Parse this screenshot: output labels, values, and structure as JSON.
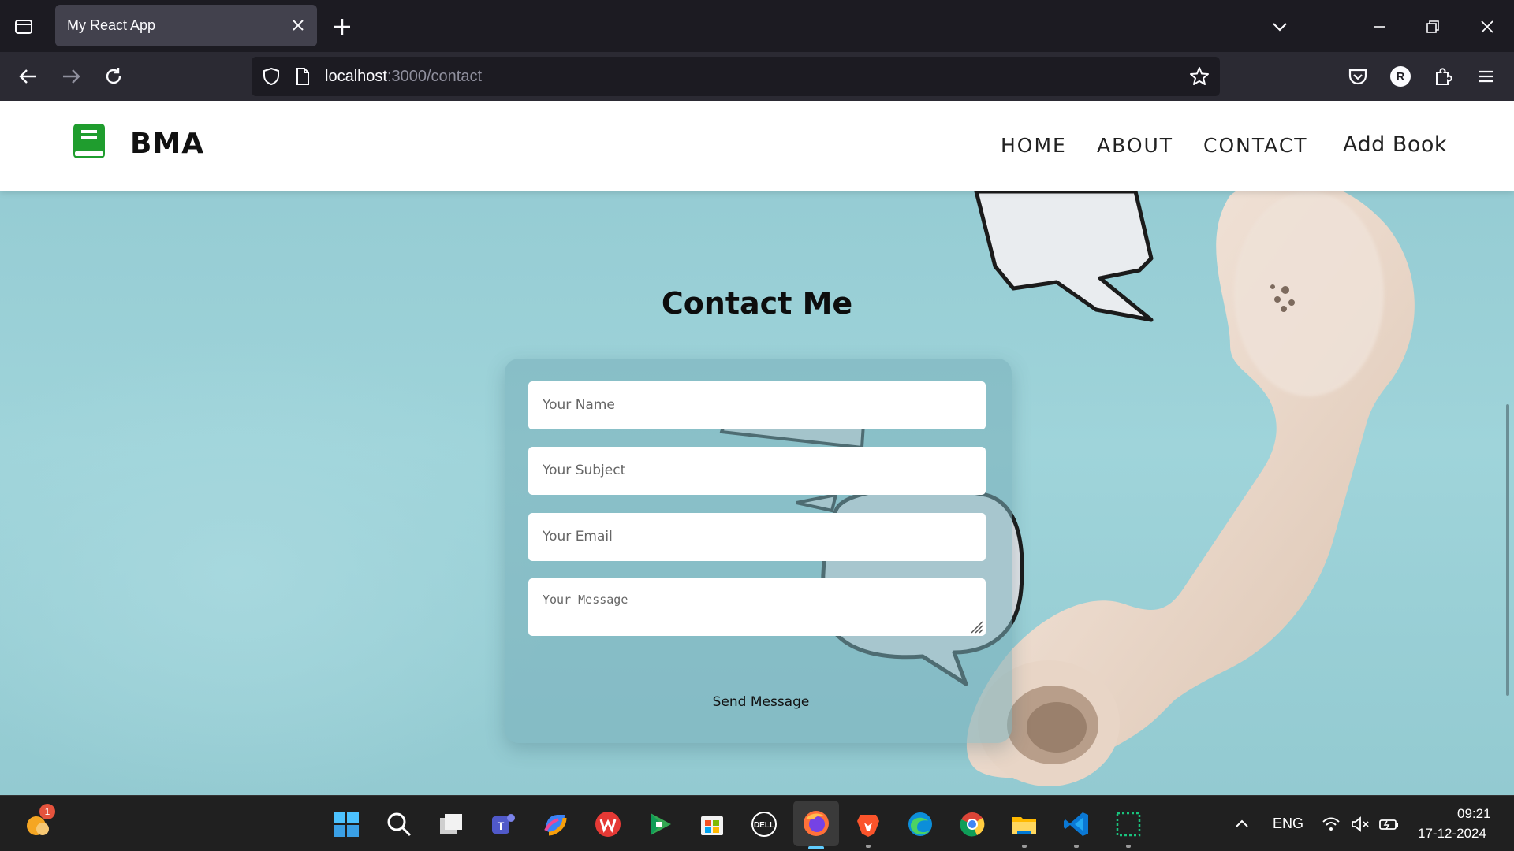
{
  "browser": {
    "tab_title": "My React App",
    "url_host": "localhost",
    "url_path": ":3000/contact",
    "profile_initial": "R"
  },
  "site": {
    "brand": "BMA",
    "menu": [
      {
        "label": "HOME"
      },
      {
        "label": "ABOUT"
      },
      {
        "label": "CONTACT"
      },
      {
        "label": "Add Book"
      }
    ]
  },
  "contact": {
    "title": "Contact Me",
    "name_placeholder": "Your Name",
    "subject_placeholder": "Your Subject",
    "email_placeholder": "Your Email",
    "message_placeholder": "Your Message",
    "send_label": "Send Message"
  },
  "taskbar": {
    "notification_count": "1",
    "language": "ENG",
    "time": "09:21",
    "date": "17-12-2024"
  },
  "colors": {
    "brand_green": "#1f9d2e",
    "page_bg": "#95ccd3",
    "chrome_dark": "#1c1b22"
  }
}
